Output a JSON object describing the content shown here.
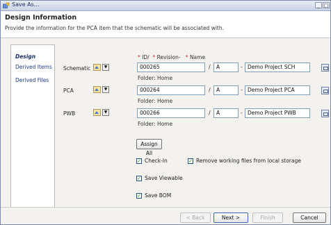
{
  "window": {
    "title": "Save As...",
    "min": "_",
    "max": "□"
  },
  "header": {
    "title": "Design Information",
    "subtitle": "Provide the information for the PCA item that the schematic will be associated with."
  },
  "nav": {
    "items": [
      "Design",
      "Derived Items",
      "Derived Files"
    ]
  },
  "columns": {
    "id": "ID/",
    "revision": "Revision-",
    "name": "Name"
  },
  "rows": [
    {
      "label": "Schematic",
      "id": "000265",
      "rev": "A",
      "name": "Demo Project SCH",
      "folder": "Folder: Home"
    },
    {
      "label": "PCA",
      "id": "000264",
      "rev": "A",
      "name": "Demo Project PCA",
      "folder": "Folder: Home"
    },
    {
      "label": "PWB",
      "id": "000266",
      "rev": "A",
      "name": "Demo Project PWB",
      "folder": "Folder: Home"
    }
  ],
  "assign_all": "Assign All",
  "options": {
    "check_in": "Check-In",
    "remove_working": "Remove working files from local storage",
    "save_viewable": "Save Viewable",
    "save_bom": "Save BOM"
  },
  "footer": {
    "back": "< Back",
    "next": "Next >",
    "finish": "Finish",
    "cancel": "Cancel"
  },
  "colors": {
    "required": "#c62828",
    "title_gradient": "#c9d3e6",
    "link": "#1e3a8a"
  }
}
